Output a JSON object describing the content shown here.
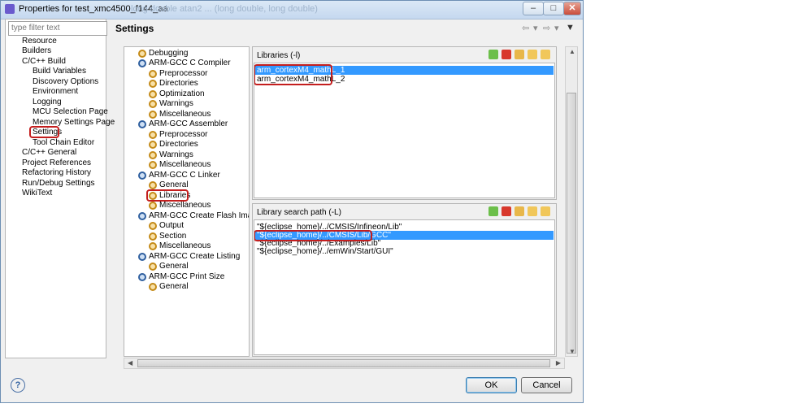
{
  "window": {
    "title": "Properties for test_xmc4500_f144_aa",
    "ghost_title": "long double atan2 ... (long double, long double)",
    "controls": {
      "minimize": "–",
      "maximize": "□",
      "close": "✕"
    }
  },
  "filter": {
    "placeholder": "type filter text"
  },
  "nav": {
    "items": [
      "Resource",
      "Builders",
      "C/C++ Build",
      "Build Variables",
      "Discovery Options",
      "Environment",
      "Logging",
      "MCU Selection Page",
      "Memory Settings Page",
      "Settings",
      "Tool Chain Editor",
      "C/C++ General",
      "Project References",
      "Refactoring History",
      "Run/Debug Settings",
      "WikiText"
    ],
    "selected": "Settings"
  },
  "settings_title": "Settings",
  "nav_arrows": {
    "back": "⇦",
    "back_menu": "▾",
    "forward": "⇨",
    "forward_menu": "▾",
    "view_menu": "▼"
  },
  "tool_tree": {
    "items": [
      "Debugging",
      "ARM-GCC C Compiler",
      "Preprocessor",
      "Directories",
      "Optimization",
      "Warnings",
      "Miscellaneous",
      "ARM-GCC Assembler",
      "Preprocessor",
      "Directories",
      "Warnings",
      "Miscellaneous",
      "ARM-GCC C Linker",
      "General",
      "Libraries",
      "Miscellaneous",
      "ARM-GCC Create Flash Image",
      "Output",
      "Section",
      "Miscellaneous",
      "ARM-GCC Create Listing",
      "General",
      "ARM-GCC Print Size",
      "General"
    ],
    "selected": "Libraries"
  },
  "libraries": {
    "label": "Libraries (-l)",
    "items": [
      "arm_cortexM4_mathL_1",
      "arm_cortexM4_mathL_2"
    ],
    "selected_index": 0
  },
  "search_path": {
    "label": "Library search path (-L)",
    "items": [
      "\"${eclipse_home}/../CMSIS/Infineon/Lib\"",
      "\"${eclipse_home}/../CMSIS/Lib/GCC\"",
      "\"${eclipse_home}/../Examples/Lib\"",
      "\"${eclipse_home}/../emWin/Start/GUI\""
    ],
    "selected_index": 1
  },
  "buttons": {
    "ok": "OK",
    "cancel": "Cancel",
    "help": "?"
  },
  "colors": {
    "selection": "#3399ff",
    "highlight": "#c41e1e"
  }
}
